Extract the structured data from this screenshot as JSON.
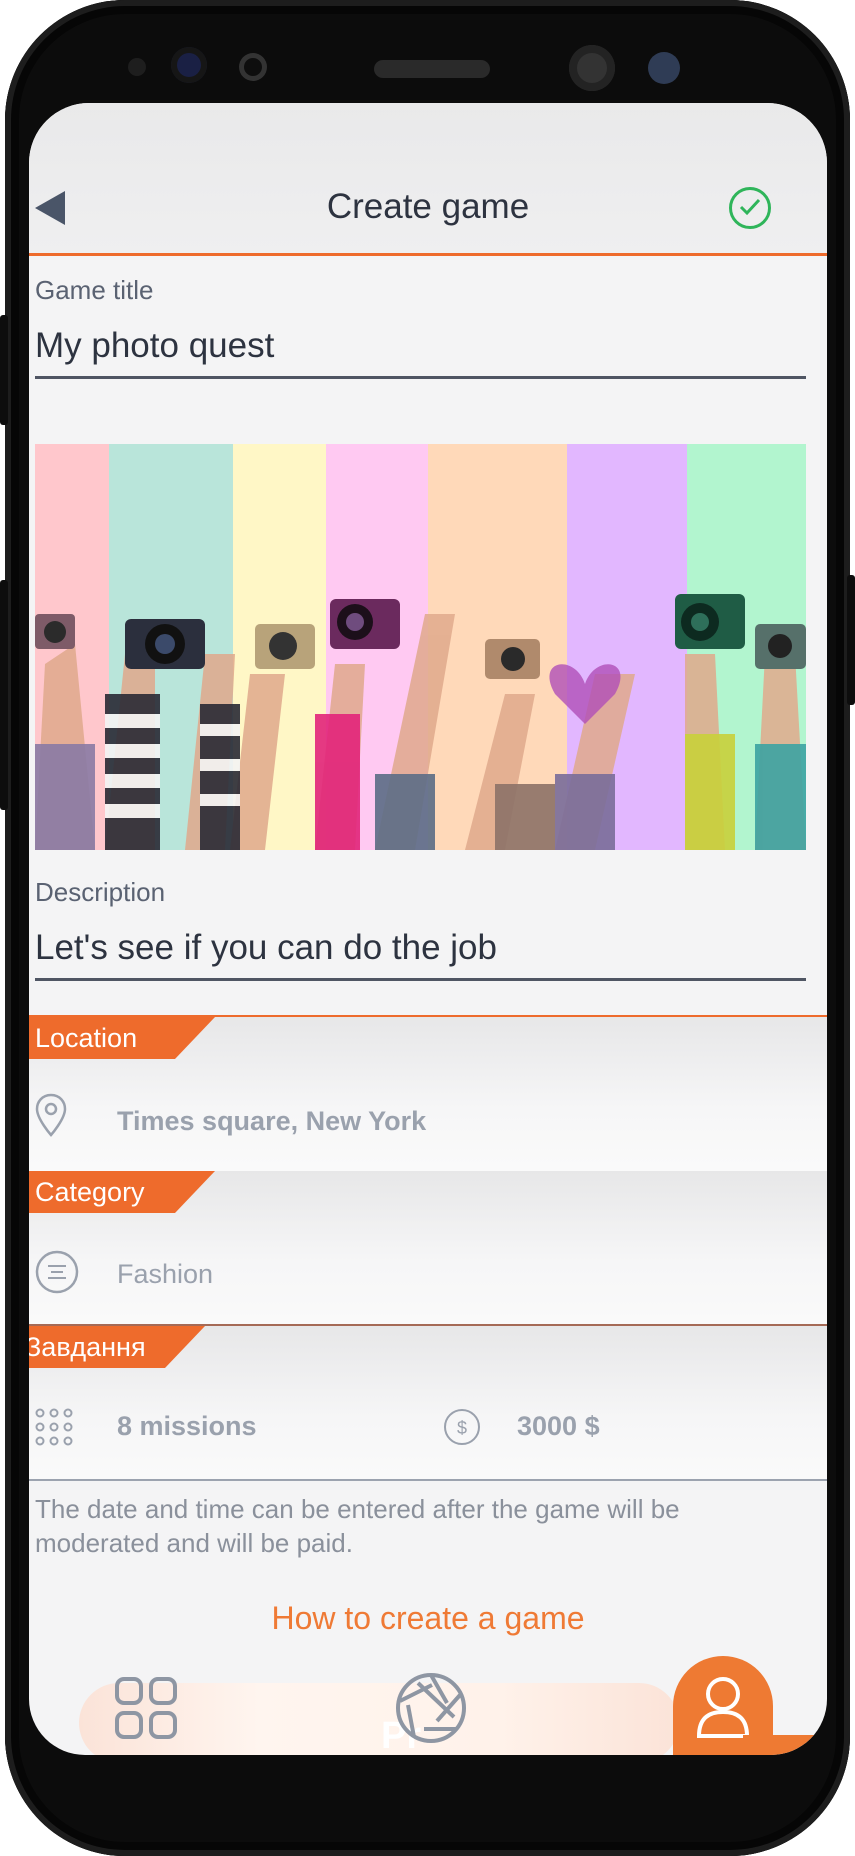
{
  "header": {
    "title": "Create game"
  },
  "game_title": {
    "label": "Game title",
    "value": "My photo quest"
  },
  "description": {
    "label": "Description",
    "value": "Let's see if you can do the job"
  },
  "location": {
    "label": "Location",
    "value": "Times square, New York"
  },
  "category": {
    "label": "Category",
    "value": "Fashion"
  },
  "tasks": {
    "label": "Завдання",
    "missions": "8 missions",
    "prize": "3000 $"
  },
  "note": "The date and time can be entered after the game will be moderated and will be paid.",
  "help_link": "How to create a game",
  "tabbar": {
    "center_text": "Pr"
  },
  "colors": {
    "accent": "#ee6b2c",
    "confirm": "#2fb55a",
    "text": "#2d3340"
  },
  "hero_stripes": [
    "#ffc7cc",
    "#b9e5da",
    "#fff7c6",
    "#ffc9f2",
    "#ffd9b9",
    "#e2b7ff",
    "#b2f5cf"
  ]
}
